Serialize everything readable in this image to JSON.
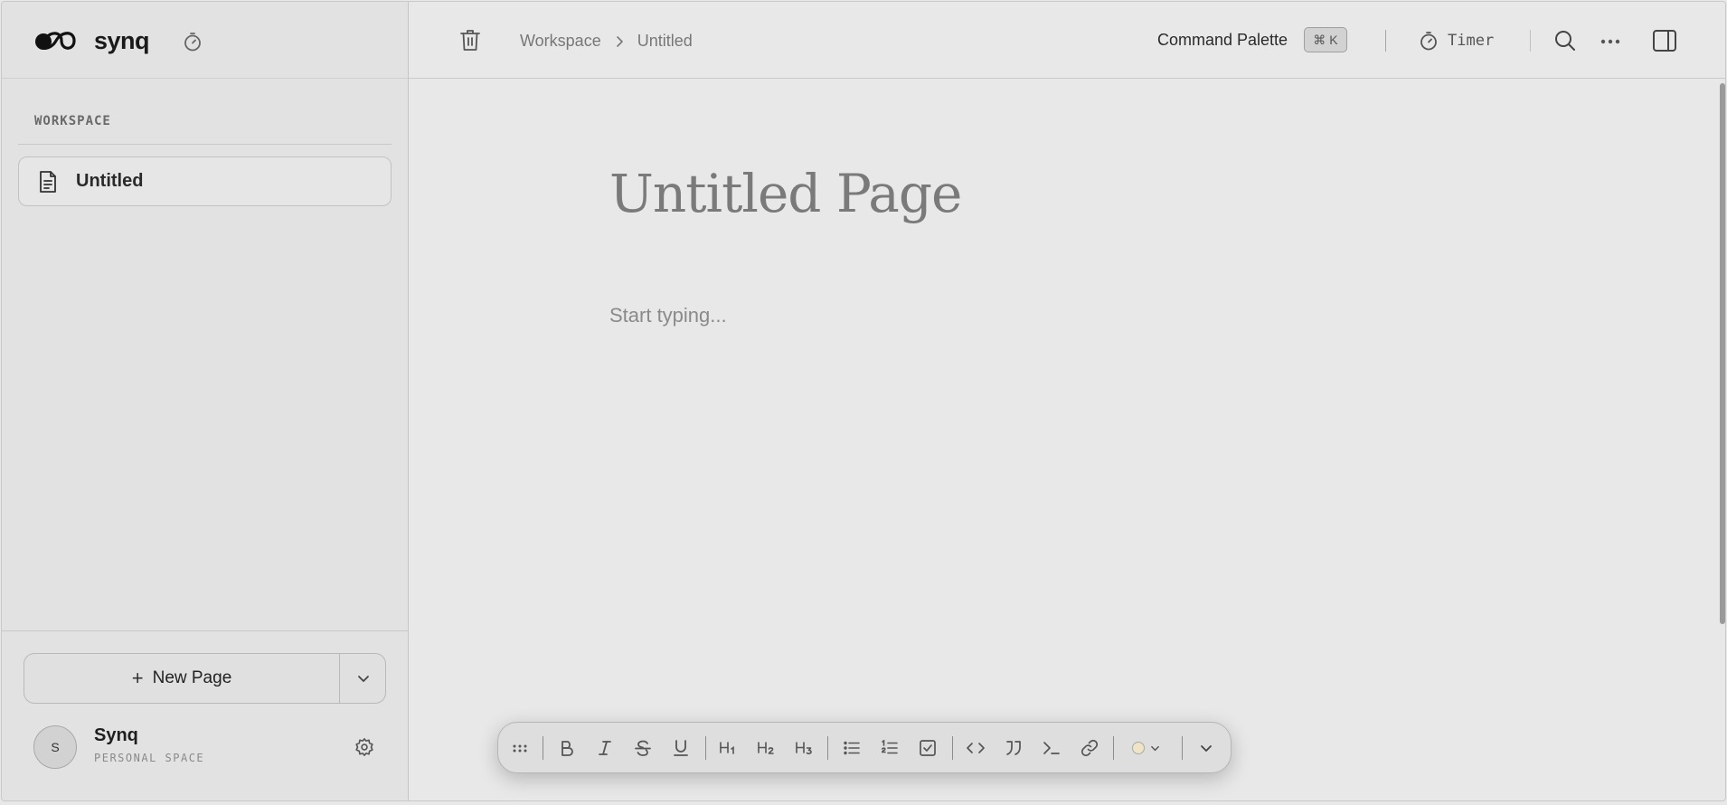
{
  "app": {
    "name": "synq"
  },
  "sidebar": {
    "section_label": "WORKSPACE",
    "pages": [
      {
        "label": "Untitled",
        "icon": "document-icon"
      }
    ],
    "new_page_label": "New Page",
    "user": {
      "initial": "S",
      "name": "Synq",
      "subtitle": "PERSONAL SPACE"
    }
  },
  "topbar": {
    "breadcrumb": [
      "Workspace",
      "Untitled"
    ],
    "command_palette_label": "Command Palette",
    "command_palette_shortcut": "⌘ K",
    "timer_label": "Timer"
  },
  "editor": {
    "title": "Untitled Page",
    "placeholder": "Start typing..."
  },
  "format_toolbar": {
    "items": [
      "drag-handle",
      "bold",
      "italic",
      "strikethrough",
      "underline",
      "heading-1",
      "heading-2",
      "heading-3",
      "bullet-list",
      "numbered-list",
      "checklist",
      "code",
      "quote",
      "code-block",
      "link",
      "text-color",
      "more"
    ],
    "heading_labels": [
      "H1",
      "H2",
      "H3"
    ],
    "text_color": "#efe4c6"
  }
}
